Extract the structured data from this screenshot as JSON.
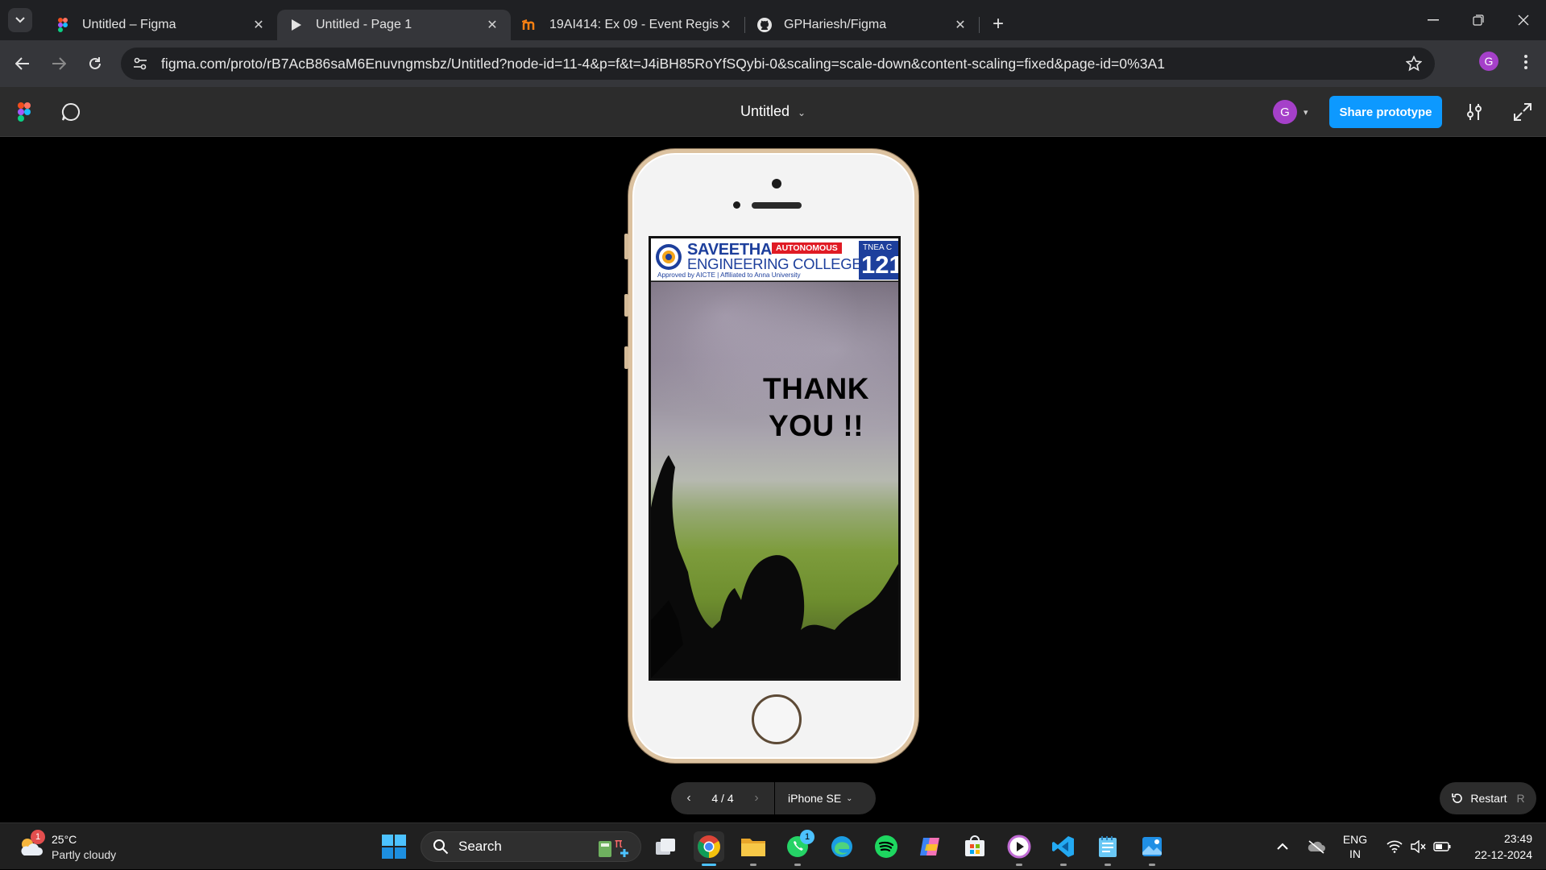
{
  "browser": {
    "tabs": [
      {
        "title": "Untitled – Figma",
        "icon": "figma-icon",
        "active": false
      },
      {
        "title": "Untitled - Page 1",
        "icon": "play-icon",
        "active": true
      },
      {
        "title": "19AI414: Ex 09 - Event Registrat",
        "icon": "moodle-icon",
        "active": false
      },
      {
        "title": "GPHariesh/Figma",
        "icon": "github-icon",
        "active": false
      }
    ],
    "url": "figma.com/proto/rB7AcB86saM6Enuvngmsbz/Untitled?node-id=11-4&p=f&t=J4iBH85RoYfSQybi-0&scaling=scale-down&content-scaling=fixed&page-id=0%3A1",
    "profile_initial": "G"
  },
  "figma": {
    "file_title": "Untitled",
    "user_initial": "G",
    "share_label": "Share prototype",
    "accent_color": "#0d99ff"
  },
  "prototype": {
    "college": {
      "name_line1": "SAVEETHA",
      "name_line2": "ENGINEERING COLLEGE",
      "badge": "AUTONOMOUS",
      "subline": "Approved by AICTE  |  Affiliated to Anna University",
      "tnea_label": "TNEA C",
      "tnea_code": "121"
    },
    "message_line1": "THANK",
    "message_line2": "YOU !!",
    "page_counter": "4 / 4",
    "device": "iPhone SE",
    "restart_label": "Restart",
    "restart_key": "R"
  },
  "taskbar": {
    "weather_temp": "25°C",
    "weather_condition": "Partly cloudy",
    "weather_badge": "1",
    "search_label": "Search",
    "whatsapp_badge": "1",
    "language_line1": "ENG",
    "language_line2": "IN",
    "time": "23:49",
    "date": "22-12-2024"
  }
}
